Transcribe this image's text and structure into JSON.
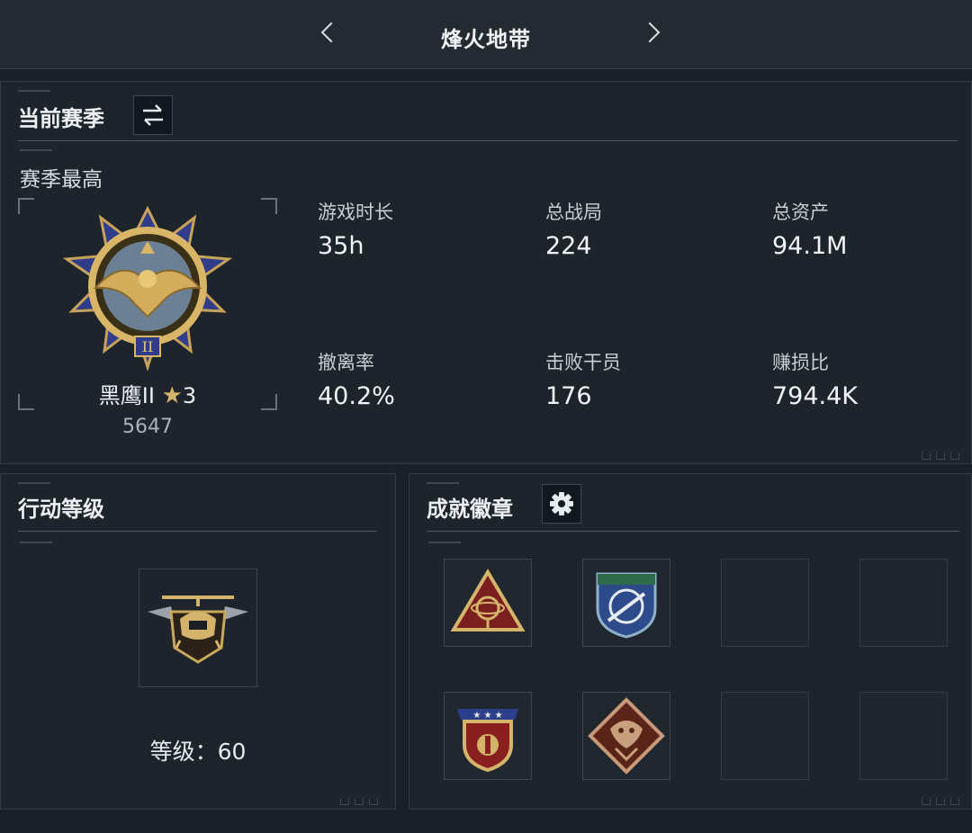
{
  "header": {
    "title": "烽火地带",
    "prev": "prev-arrow",
    "next": "next-arrow"
  },
  "season": {
    "section_title": "当前赛季",
    "switch_icon": "swap-icon",
    "best_label": "赛季最高",
    "rank_name": "黑鹰II",
    "rank_star_icon": "star-icon",
    "rank_stars": "3",
    "rank_score": "5647",
    "stats": [
      {
        "label": "游戏时长",
        "value": "35h"
      },
      {
        "label": "总战局",
        "value": "224"
      },
      {
        "label": "总资产",
        "value": "94.1M"
      },
      {
        "label": "撤离率",
        "value": "40.2%"
      },
      {
        "label": "击败干员",
        "value": "176"
      },
      {
        "label": "赚损比",
        "value": "794.4K"
      }
    ]
  },
  "operation_level": {
    "section_title": "行动等级",
    "level_label": "等级：",
    "level_value": "60"
  },
  "achievements": {
    "section_title": "成就徽章",
    "settings_icon": "gear-icon",
    "badges": [
      {
        "icon": "triangle-gyro-badge"
      },
      {
        "icon": "shield-rifle-badge"
      },
      {
        "icon": "empty-slot"
      },
      {
        "icon": "empty-slot"
      },
      {
        "icon": "star-shield-badge"
      },
      {
        "icon": "dragon-diamond-badge"
      },
      {
        "icon": "empty-slot"
      },
      {
        "icon": "empty-slot"
      }
    ]
  },
  "colors": {
    "background": "#1a2028",
    "panel": "#1d242c",
    "gold": "#d4b46b",
    "blue": "#3a4a9a",
    "text": "#e6ebef"
  }
}
